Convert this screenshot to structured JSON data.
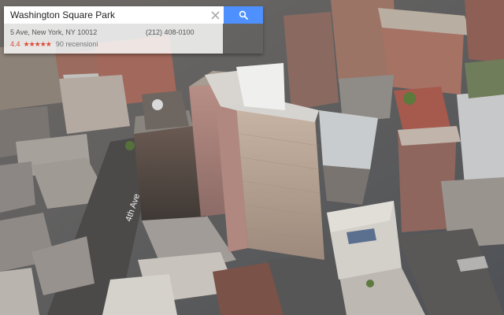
{
  "search": {
    "query": "Washington Square Park",
    "clear_icon": "close-icon",
    "search_icon": "search-icon",
    "button_color": "#4d90fe"
  },
  "place": {
    "address": "5 Ave, New York, NY 10012",
    "phone": "(212) 408-0100",
    "rating": "4.4",
    "stars": "★★★★★",
    "reviews": "90 recensioni",
    "rating_color": "#dd4b39"
  },
  "map": {
    "street_label": "4th Ave",
    "view": "3D aerial satellite"
  }
}
